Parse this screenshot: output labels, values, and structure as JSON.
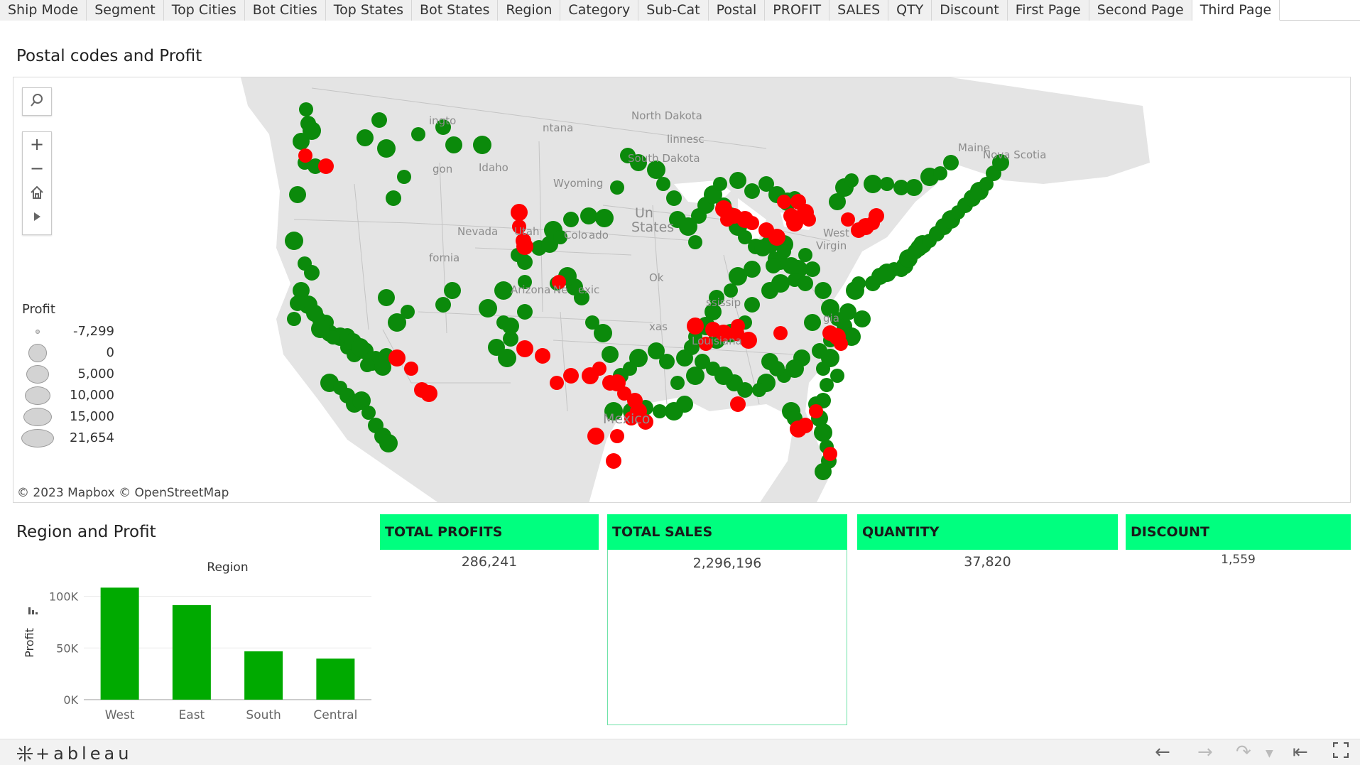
{
  "tabs": [
    "Ship Mode",
    "Segment",
    "Top Cities",
    "Bot Cities",
    "Top States",
    "Bot States",
    "Region",
    "Category",
    "Sub-Cat",
    "Postal",
    "PROFIT",
    "SALES",
    "QTY",
    "Discount",
    "First Page",
    "Second Page",
    "Third Page"
  ],
  "active_tab": "Third Page",
  "map": {
    "title": "Postal codes and Profit",
    "legend_title": "Profit",
    "legend_values": [
      "-7,299",
      "0",
      "5,000",
      "10,000",
      "15,000",
      "21,654"
    ],
    "attribution": "© 2023 Mapbox  © OpenStreetMap",
    "place_labels": [
      "ingto",
      "ntana",
      "North Dakota",
      "linnesc",
      "South Dakota",
      "gon",
      "Idaho",
      "Wyoming",
      "Un",
      "States",
      "Nevada",
      "Utah",
      "Colo",
      "ado",
      "fornia",
      "Arizona",
      "Ne",
      "exic",
      "Ok",
      "xas",
      "Louisiana",
      "ssissip",
      "gia",
      "West",
      "Virgin",
      "Maine",
      "Nova Scotia",
      "Mexico"
    ],
    "colors": {
      "profit_positive": "#0b8a0b",
      "profit_negative": "#ff0000",
      "land": "#e5e5e5",
      "water": "#ffffff"
    }
  },
  "chart_data": {
    "type": "bar",
    "title": "Region and Profit",
    "header": "Region",
    "categories": [
      "West",
      "East",
      "South",
      "Central"
    ],
    "values": [
      108418,
      91523,
      46749,
      39706
    ],
    "ylabel": "Profit",
    "yticks": [
      "100K",
      "50K",
      "0K"
    ],
    "ylim": [
      0,
      110000
    ],
    "color": "#00aa00"
  },
  "kpis": {
    "total_profits": {
      "label": "TOTAL PROFITS",
      "value": "286,241"
    },
    "total_sales": {
      "label": "TOTAL SALES",
      "value": "2,296,196"
    },
    "quantity": {
      "label": "QUANTITY",
      "value": "37,820"
    },
    "discount": {
      "label": "DISCOUNT",
      "value": "1,559"
    }
  },
  "footer": {
    "logo_text": "+ableau"
  }
}
